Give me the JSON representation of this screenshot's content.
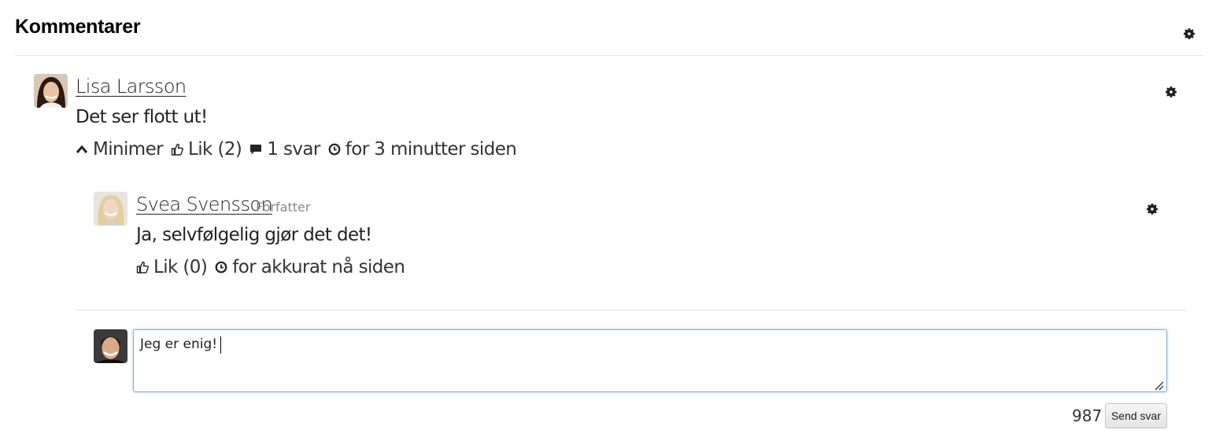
{
  "header": {
    "title": "Kommentarer",
    "settings_icon": "gear-icon"
  },
  "comments": [
    {
      "author": "Lisa Larsson",
      "text": "Det ser flott ut!",
      "actions": {
        "minimize": "Minimer",
        "like": "Lik (2)",
        "replies": "1 svar",
        "time": "for 3 minutter siden"
      },
      "replies": [
        {
          "author": "Svea Svensson",
          "role": "Forfatter",
          "text": "Ja, selvfølgelig gjør det det!",
          "actions": {
            "like": "Lik (0)",
            "time": "for akkurat nå siden"
          }
        }
      ]
    }
  ],
  "reply_form": {
    "value": "Jeg er enig!",
    "remaining_chars": "987",
    "submit_label": "Send svar"
  }
}
